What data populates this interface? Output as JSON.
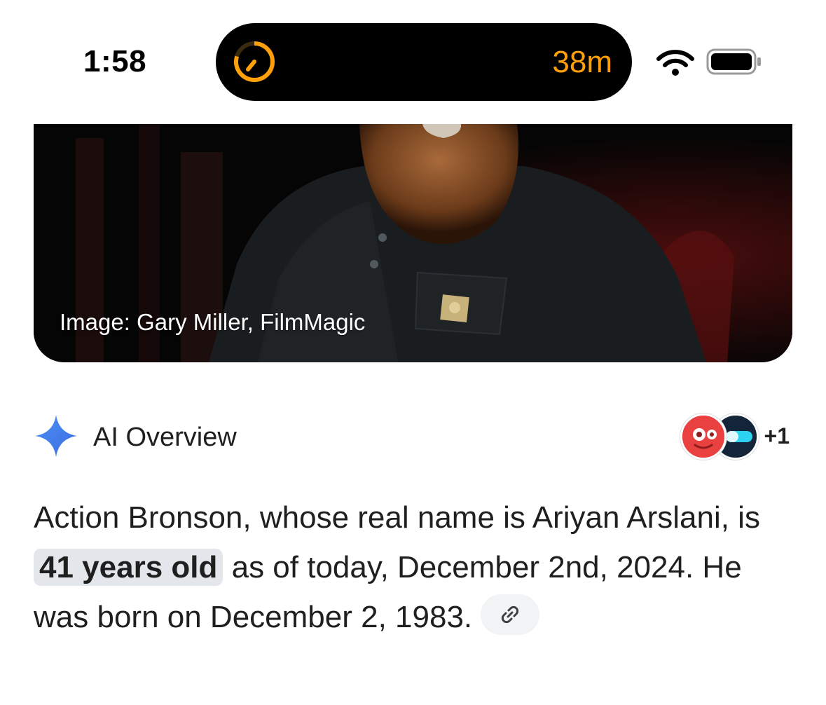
{
  "status_bar": {
    "time": "1:58",
    "island_timer": "38m",
    "icons": {
      "timer": "timer-progress-icon",
      "wifi": "wifi-icon",
      "battery": "battery-icon"
    },
    "colors": {
      "island_accent": "#ff9f0a"
    }
  },
  "image_card": {
    "credit": "Image: Gary Miller, FilmMagic"
  },
  "ai_overview": {
    "title": "AI Overview",
    "icon": "sparkle-icon",
    "sources_more": "+1",
    "colors": {
      "sparkle": "#4285f4"
    }
  },
  "answer": {
    "part1": "Action Bronson, whose real name is Ariyan Arslani, is ",
    "highlight": "41 years old",
    "part2": " as of today, December 2nd, 2024. He was born on December 2, 1983.",
    "link_icon": "link-icon"
  }
}
